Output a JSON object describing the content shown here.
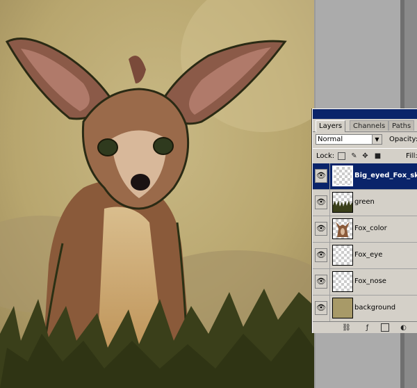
{
  "panel": {
    "tabs": [
      "Layers",
      "Channels",
      "Paths"
    ],
    "blend_mode": "Normal",
    "opacity_label": "Opacity:",
    "lock_label": "Lock:",
    "fill_label": "Fill:",
    "layers": [
      {
        "name": "Big_eyed_Fox_sketch",
        "selected": true,
        "thumb": "transparent"
      },
      {
        "name": "green",
        "selected": false,
        "thumb": "grass"
      },
      {
        "name": "Fox_color",
        "selected": false,
        "thumb": "fox"
      },
      {
        "name": "Fox_eye",
        "selected": false,
        "thumb": "transparent"
      },
      {
        "name": "Fox_nose",
        "selected": false,
        "thumb": "transparent"
      },
      {
        "name": "background",
        "selected": false,
        "thumb": "background"
      }
    ],
    "bottom_icons": [
      "link-icon",
      "layer-style-icon",
      "mask-icon",
      "adjustment-icon"
    ]
  },
  "colors": {
    "accent": "#0a246a",
    "panel_bg": "#d4d0c8",
    "canvas_bg": "#c2b078",
    "fox": "#8a5a3a"
  }
}
